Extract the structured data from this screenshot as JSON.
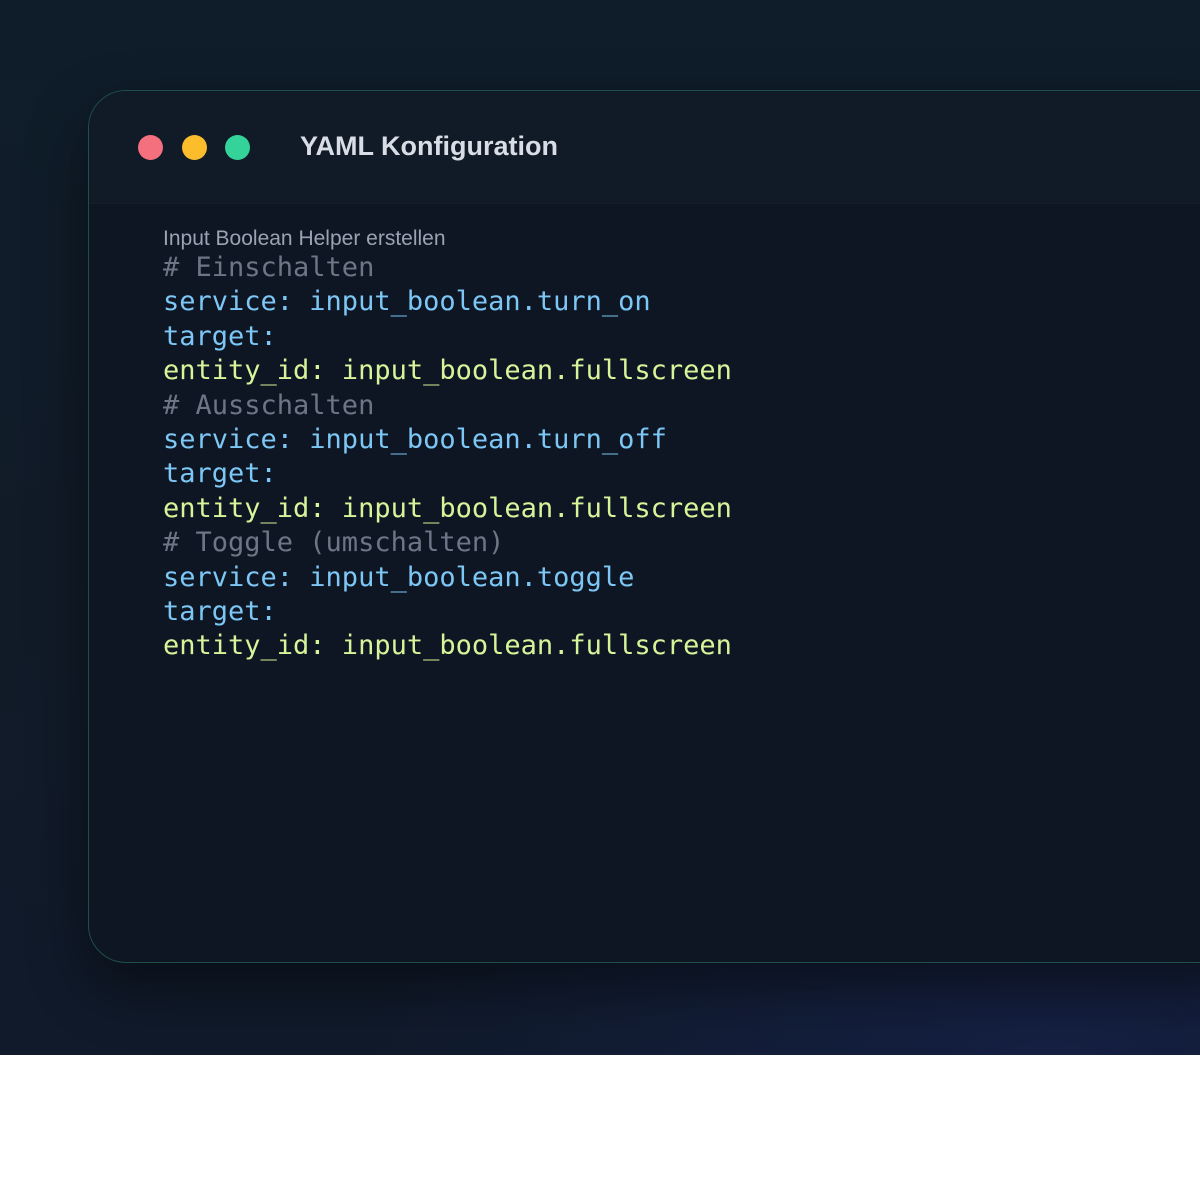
{
  "window": {
    "title": "YAML Konfiguration",
    "controls": [
      "close",
      "minimize",
      "maximize"
    ]
  },
  "editor": {
    "caption": "Input Boolean Helper erstellen",
    "lines": [
      {
        "text": "# Einschalten",
        "kind": "comment"
      },
      {
        "text": "service: input_boolean.turn_on",
        "kind": "service"
      },
      {
        "text": "target:",
        "kind": "service"
      },
      {
        "text": "entity_id: input_boolean.fullscreen",
        "kind": "entity"
      },
      {
        "text": "# Ausschalten",
        "kind": "comment"
      },
      {
        "text": "service: input_boolean.turn_off",
        "kind": "service"
      },
      {
        "text": "target:",
        "kind": "service"
      },
      {
        "text": "entity_id: input_boolean.fullscreen",
        "kind": "entity"
      },
      {
        "text": "# Toggle (umschalten)",
        "kind": "comment"
      },
      {
        "text": "service: input_boolean.toggle",
        "kind": "service"
      },
      {
        "text": "target:",
        "kind": "service"
      },
      {
        "text": "entity_id: input_boolean.fullscreen",
        "kind": "entity"
      }
    ]
  },
  "colors": {
    "comment": "#6c7686",
    "service": "#7cc7f5",
    "entity": "#d6f59a",
    "close": "#f5707e",
    "minimize": "#fbbd2b",
    "maximize": "#34d399"
  }
}
